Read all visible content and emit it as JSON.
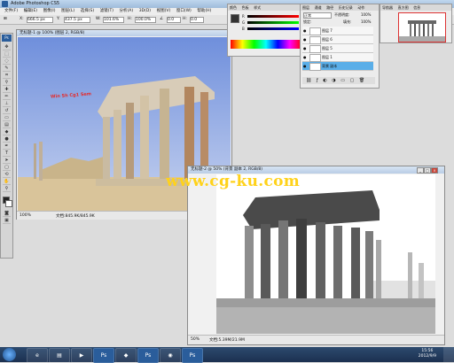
{
  "app": {
    "title": "Adobe Photoshop CS5"
  },
  "menu": [
    "文件(F)",
    "编辑(E)",
    "图像(I)",
    "图层(L)",
    "选择(S)",
    "滤镜(T)",
    "分析(A)",
    "3D(D)",
    "视图(V)",
    "窗口(W)",
    "帮助(H)"
  ],
  "options_bar": {
    "x": "666.5 px",
    "y": "437.5 px",
    "w": "101.6%",
    "h": "100.0%",
    "angle": "0.0",
    "h_skew": "0.0"
  },
  "doc1": {
    "title": "无标题-1 @ 100% (图层 2, RGB/8)",
    "zoom": "100%",
    "status": "文档:845.9K/845.9K",
    "overlay_text": "Win Sh Cg1 Sem"
  },
  "doc2": {
    "title": "无标题-2 @ 50% (背景 副本 2, RGB/8)",
    "zoom": "50%",
    "status": "文档:5.39M/21.9M"
  },
  "color_panel": {
    "tabs": [
      "颜色",
      "色板",
      "样式"
    ],
    "channels": [
      "R",
      "G",
      "B"
    ]
  },
  "layers_panel": {
    "tabs": [
      "图层",
      "通道",
      "路径",
      "历史记录",
      "动作"
    ],
    "blend_mode": "正常",
    "opacity_label": "不透明度:",
    "opacity": "100%",
    "lock_label": "锁定:",
    "fill_label": "填充:",
    "fill": "100%",
    "layers": [
      "图层 7",
      "图层 6",
      "图层 5",
      "图层 1",
      "背景 副本"
    ]
  },
  "nav_panel": {
    "tabs": [
      "导航器",
      "直方图",
      "信息"
    ]
  },
  "watermark": "www.cg-ku.com",
  "taskbar": {
    "apps": [
      "ie",
      "explorer",
      "media",
      "ps",
      "ps2",
      "chrome",
      "ps3"
    ],
    "time": "15:56",
    "date": "2012/9/9"
  },
  "colors": {
    "accent": "#2a5d9b",
    "selected_layer": "#5aaee8",
    "watermark": "#ffd21a"
  }
}
